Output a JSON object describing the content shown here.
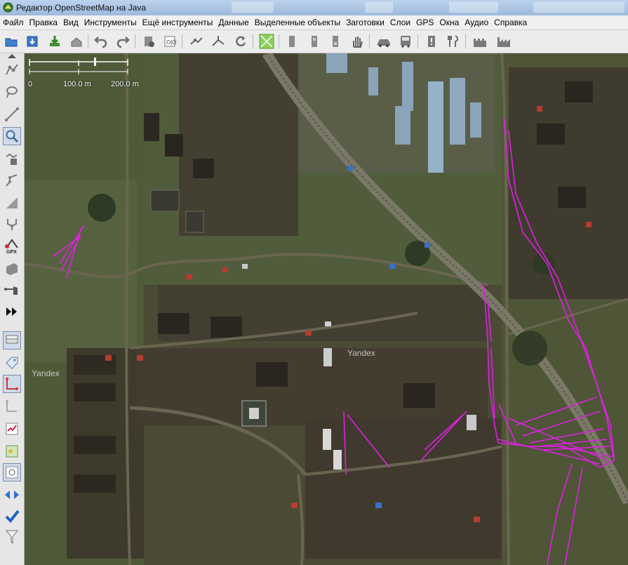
{
  "window": {
    "title": "Редактор OpenStreetMap на Java"
  },
  "menu": {
    "items": [
      "Файл",
      "Правка",
      "Вид",
      "Инструменты",
      "Ещё инструменты",
      "Данные",
      "Выделенные объекты",
      "Заготовки",
      "Слои",
      "GPS",
      "Окна",
      "Аудио",
      "Справка"
    ]
  },
  "toolbar": {
    "icons": [
      "open-file-icon",
      "save-icon",
      "download-icon",
      "upload-icon",
      "undo-icon",
      "redo-icon",
      "preferences-icon",
      "tag-presets-icon",
      "combine-way-icon",
      "split-way-icon",
      "reload-icon",
      "imagery-icon",
      "parking-icon",
      "bus-stop-icon",
      "hand-icon",
      "car-icon",
      "bus-icon",
      "info-icon",
      "restaurant-icon",
      "castle-icon",
      "industrial-icon"
    ]
  },
  "sidebar": {
    "icons": [
      "select-icon",
      "lasso-icon",
      "draw-icon",
      "zoom-icon",
      "delete-icon",
      "improve-way-icon",
      "parallel-icon",
      "split-icon",
      "gpx-icon",
      "area-icon",
      "nodes-icon",
      "expand-icon",
      "layers-icon",
      "tags-icon",
      "relations-icon",
      "history-icon",
      "validator-icon",
      "conflict-icon",
      "filter-icon",
      "notes-icon",
      "checkmark-icon",
      "funnel-icon"
    ]
  },
  "map": {
    "watermarks": [
      "Yandex",
      "Yandex"
    ],
    "gps_track_color": "#e21ee6"
  },
  "scale_bar": {
    "labels": [
      "0",
      "100.0 m",
      "200.0 m"
    ]
  }
}
